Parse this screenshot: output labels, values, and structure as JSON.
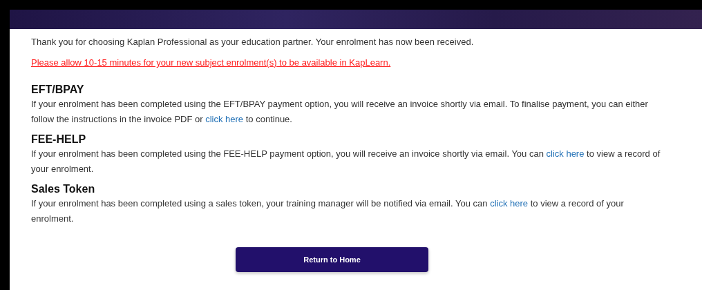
{
  "intro": "Thank you for choosing Kaplan Professional as your education partner. Your enrolment has now been received.",
  "notice": "Please allow 10-15 minutes for your new subject enrolment(s) to be available in KapLearn.",
  "sections": [
    {
      "heading": "EFT/BPAY",
      "text_before": "If your enrolment has been completed using the EFT/BPAY payment option, you will receive an invoice shortly via email. To finalise payment, you can either follow the instructions in the invoice PDF or",
      "link": "click here",
      "text_after": "to continue."
    },
    {
      "heading": "FEE-HELP",
      "text_before": "If your enrolment has been completed using the FEE-HELP payment option, you will receive an invoice shortly via email. You can",
      "link": "click here",
      "text_after": "to view a record of your enrolment."
    },
    {
      "heading": "Sales Token",
      "text_before": "If your enrolment has been completed using a sales token, your training manager will be notified via email. You can",
      "link": "click here",
      "text_after": "to view a record of your enrolment."
    }
  ],
  "button": "Return to Home"
}
